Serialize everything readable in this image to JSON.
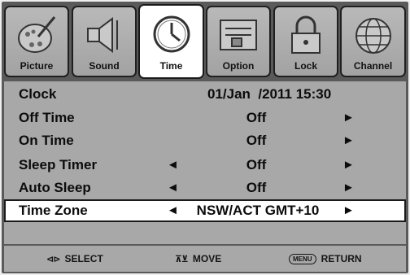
{
  "tabs": [
    {
      "label": "Picture",
      "icon": "palette-icon",
      "active": false
    },
    {
      "label": "Sound",
      "icon": "speaker-icon",
      "active": false
    },
    {
      "label": "Time",
      "icon": "clock-icon",
      "active": true
    },
    {
      "label": "Option",
      "icon": "option-icon",
      "active": false
    },
    {
      "label": "Lock",
      "icon": "lock-icon",
      "active": false
    },
    {
      "label": "Channel",
      "icon": "globe-icon",
      "active": false
    }
  ],
  "menu": {
    "clock": {
      "label": "Clock",
      "value": "01/Jan  /2011 15:30"
    },
    "off_time": {
      "label": "Off Time",
      "value": "Off"
    },
    "on_time": {
      "label": "On Time",
      "value": "Off"
    },
    "sleep_timer": {
      "label": "Sleep Timer",
      "value": "Off"
    },
    "auto_sleep": {
      "label": "Auto Sleep",
      "value": "Off"
    },
    "time_zone": {
      "label": "Time Zone",
      "value": "NSW/ACT GMT+10"
    }
  },
  "arrows": {
    "left": "◄",
    "right": "►"
  },
  "footer": {
    "select": "SELECT",
    "move": "MOVE",
    "menu_key": "MENU",
    "return": "RETURN"
  },
  "colors": {
    "panel": "#a8a8a8",
    "frame": "#5a5a5a",
    "tab": "#b0b0b0",
    "active_tab": "#ffffff"
  }
}
